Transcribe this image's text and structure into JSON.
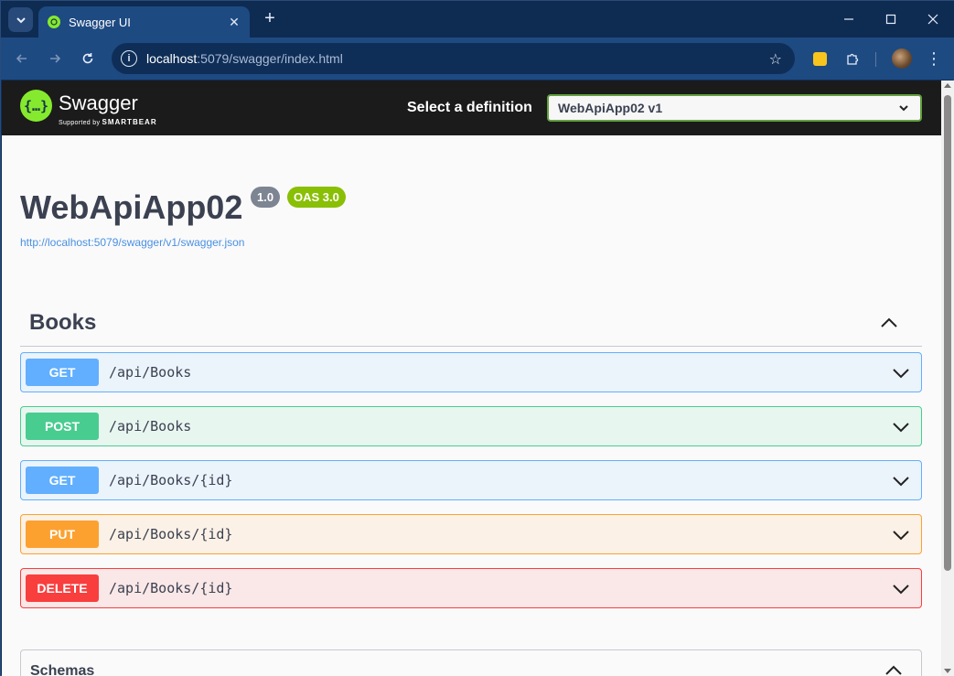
{
  "browser": {
    "tab_title": "Swagger UI",
    "url_host": "localhost",
    "url_path": ":5079/swagger/index.html"
  },
  "swagger": {
    "brand": "Swagger",
    "tagline_prefix": "Supported by",
    "tagline_brand": "SMARTBEAR",
    "definition_label": "Select a definition",
    "definition_selected": "WebApiApp02 v1"
  },
  "info": {
    "title": "WebApiApp02",
    "version": "1.0",
    "oas": "OAS 3.0",
    "spec_url": "http://localhost:5079/swagger/v1/swagger.json"
  },
  "tag": {
    "name": "Books",
    "operations": [
      {
        "method": "GET",
        "path": "/api/Books"
      },
      {
        "method": "POST",
        "path": "/api/Books"
      },
      {
        "method": "GET",
        "path": "/api/Books/{id}"
      },
      {
        "method": "PUT",
        "path": "/api/Books/{id}"
      },
      {
        "method": "DELETE",
        "path": "/api/Books/{id}"
      }
    ]
  },
  "schemas": {
    "label": "Schemas"
  },
  "colors": {
    "get": "#61affe",
    "post": "#49cc90",
    "put": "#fca130",
    "delete": "#f93e3e",
    "swagger_green": "#85ea2d"
  }
}
